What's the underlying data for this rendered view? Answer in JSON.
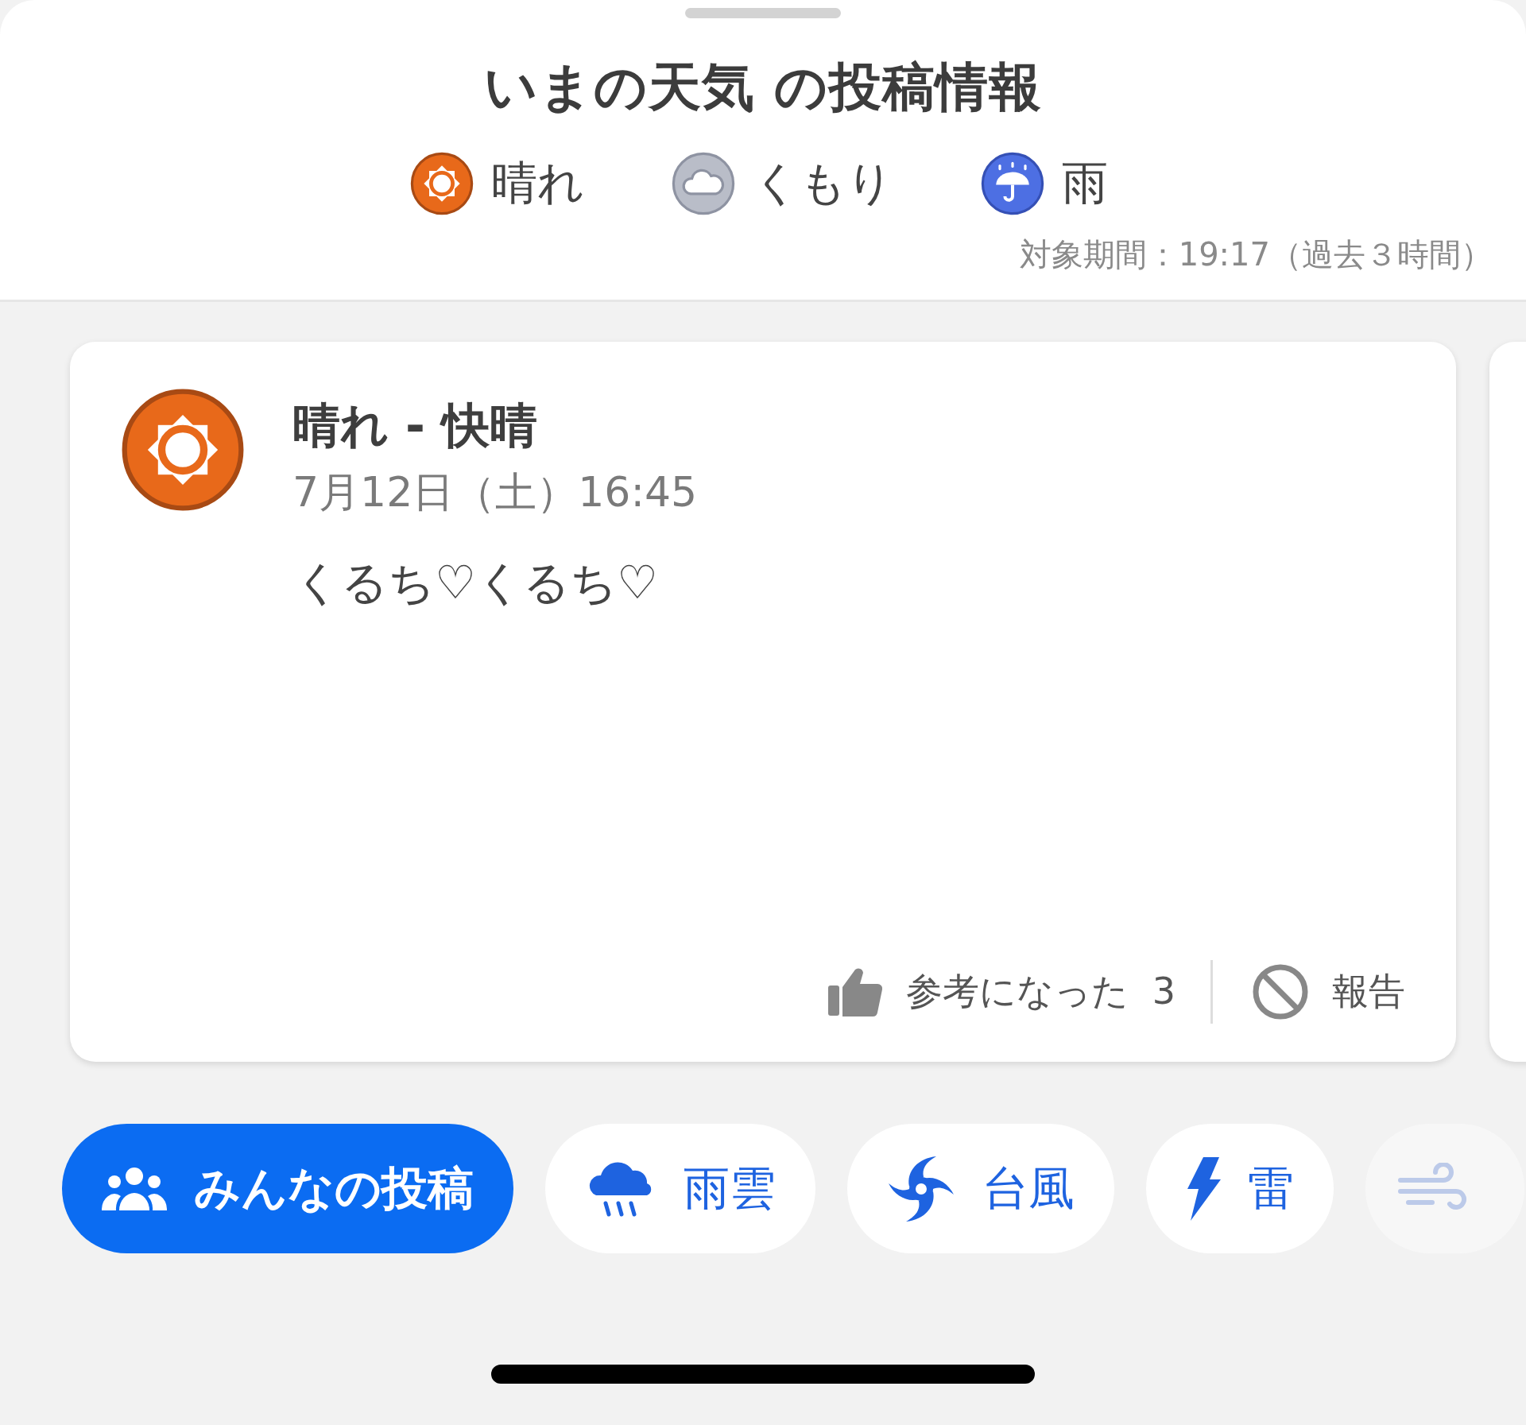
{
  "sheet": {
    "title": "いまの天気 の投稿情報",
    "legend": [
      {
        "kind": "sunny",
        "label": "晴れ"
      },
      {
        "kind": "cloudy",
        "label": "くもり"
      },
      {
        "kind": "rain",
        "label": "雨"
      }
    ],
    "period": "対象期間：19:17（過去３時間）"
  },
  "posts": [
    {
      "kind": "sunny",
      "title": "晴れ - 快晴",
      "date": "7月12日（土）16:45",
      "body": "くるち♡くるち♡",
      "helpful_label": "参考になった",
      "helpful_count": "3",
      "report_label": "報告"
    }
  ],
  "chips": [
    {
      "kind": "people",
      "label": "みんなの投稿",
      "selected": true
    },
    {
      "kind": "rain-cloud",
      "label": "雨雲",
      "selected": false
    },
    {
      "kind": "typhoon",
      "label": "台風",
      "selected": false
    },
    {
      "kind": "lightning",
      "label": "雷",
      "selected": false
    },
    {
      "kind": "wind",
      "selected": false
    }
  ]
}
